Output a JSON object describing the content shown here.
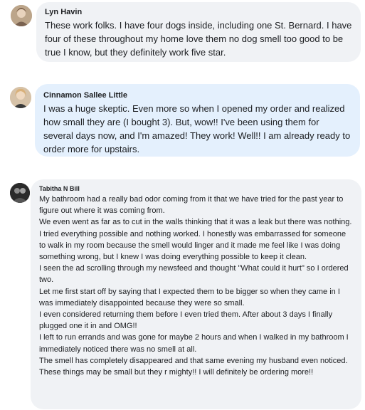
{
  "comments": [
    {
      "author": "Lyn Havin",
      "text": "These work folks. I have four dogs inside, including one St. Bernard. I have four of these throughout my home love them no dog smell too good to be true I know, but they definitely work five star."
    },
    {
      "author": "Cinnamon Sallee Little",
      "text": "I was a huge skeptic. Even more so when I opened my order and realized how small they are (I bought 3). But, wow!! I've been using them for several days now, and I'm amazed! They work! Well!! I am already ready to order more for upstairs."
    },
    {
      "author": "Tabitha N Bill",
      "paragraphs": [
        "My bathroom had a really bad odor coming from it that we have tried for the past year to figure out where it was coming from.",
        "We even went as far as to cut in the walls thinking that it was a leak but there was nothing.",
        "I tried everything possible and nothing worked. I honestly was embarrassed for someone to walk in my room because the smell would linger and it made me feel like I was doing something wrong, but I knew I was doing everything possible to keep it clean.",
        "I seen the ad scrolling through my newsfeed and thought \"What could it hurt\" so I ordered two.",
        "Let me first start off by saying that I expected them to be bigger so when they came in I was immediately disappointed because they were so small.",
        "I even considered returning them before I even tried them. After about 3 days I finally plugged one it in and OMG!!",
        "I left to run errands and was gone for maybe 2 hours and when I walked in my bathroom I immediately noticed there was no smell at all.",
        "The smell has completely disappeared and that same evening my husband even noticed.",
        "These things may be small but they r mighty!! I will definitely be ordering more!!"
      ]
    }
  ]
}
